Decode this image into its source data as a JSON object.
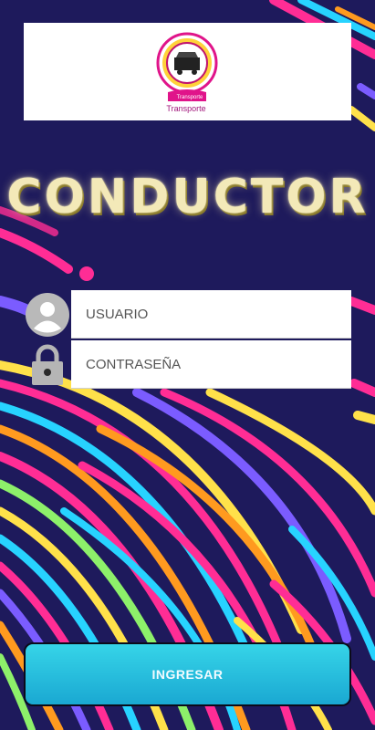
{
  "logo": {
    "brand_text": "Transporte",
    "sub_text": "Transporte"
  },
  "title": "CONDUCTOR",
  "form": {
    "username_placeholder": "USUARIO",
    "password_placeholder": "CONTRASEÑA"
  },
  "submit_label": "INGRESAR",
  "colors": {
    "background": "#1e1a5c",
    "accent_magenta": "#e0148a",
    "button": "#1fb7d9",
    "title": "#f3e9b8"
  },
  "icons": {
    "user": "user-avatar-icon",
    "lock": "lock-icon"
  }
}
